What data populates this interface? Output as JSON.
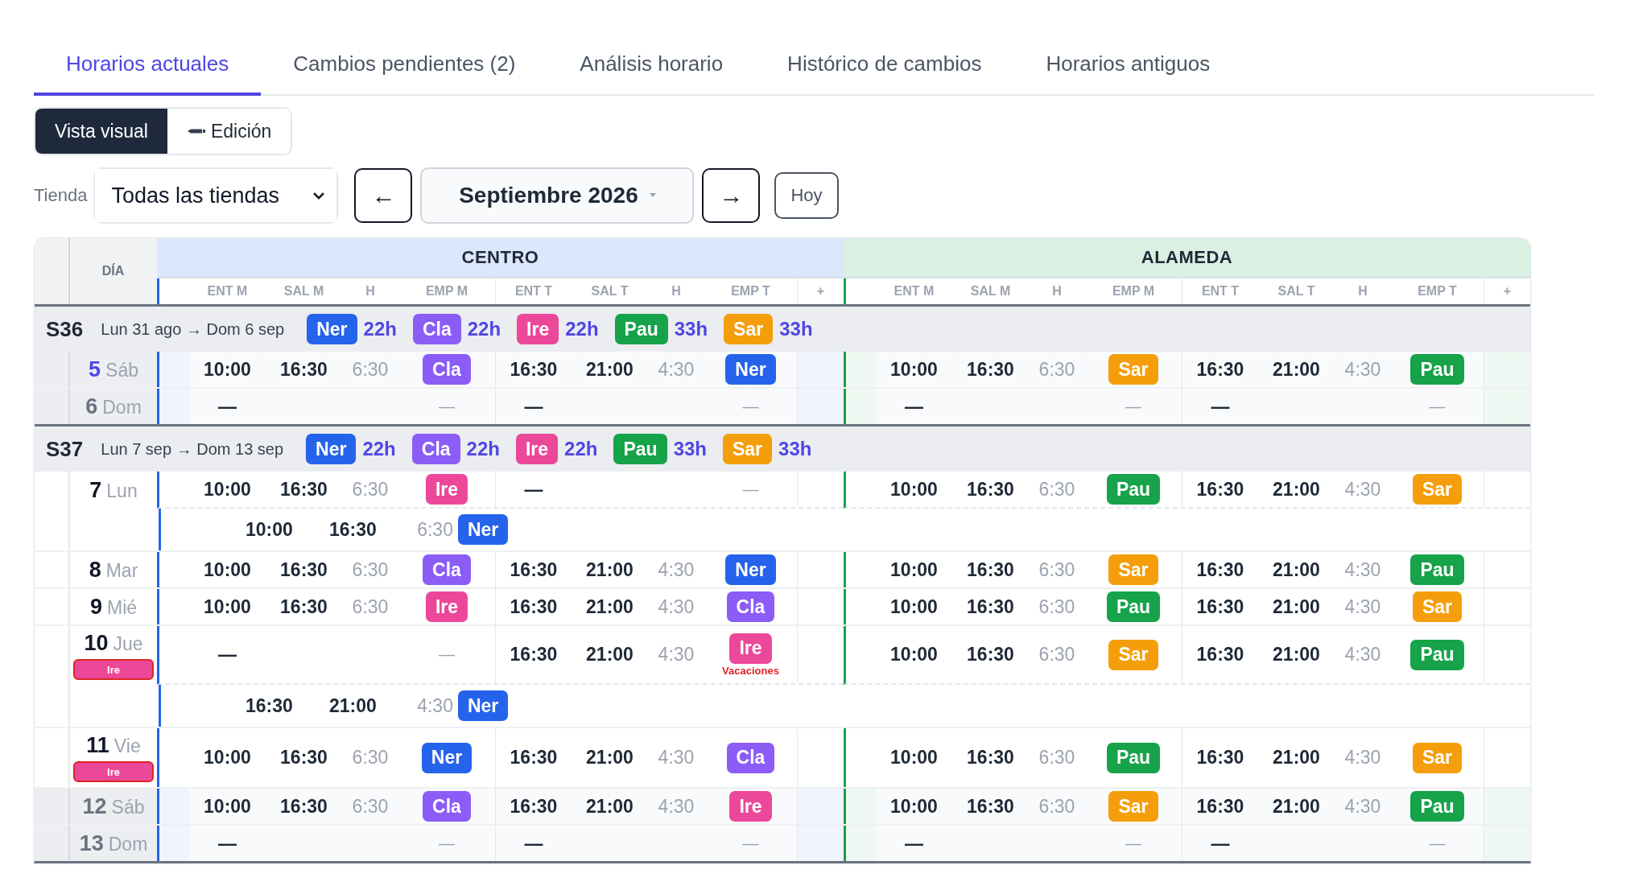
{
  "tabs": [
    {
      "label": "Horarios actuales",
      "selected": true
    },
    {
      "label": "Cambios pendientes (2)",
      "selected": false
    },
    {
      "label": "Análisis horario",
      "selected": false
    },
    {
      "label": "Histórico de cambios",
      "selected": false
    },
    {
      "label": "Horarios antiguos",
      "selected": false
    }
  ],
  "view_modes": [
    {
      "label": "Vista visual",
      "selected": true,
      "kind": "plain"
    },
    {
      "label": "Edición",
      "selected": false,
      "kind": "pencil"
    }
  ],
  "filters": {
    "store_label": "Tienda",
    "store_value": "Todas las tiendas",
    "prev": "←",
    "month": "Septiembre 2026",
    "next": "→",
    "today": "Hoy"
  },
  "table": {
    "day_header": "DÍA",
    "stores": [
      {
        "name": "CENTRO",
        "color": "#2563eb",
        "columns": [
          "ENT M",
          "SAL M",
          "H",
          "EMP M",
          "ENT T",
          "SAL T",
          "H",
          "EMP T",
          "+"
        ]
      },
      {
        "name": "ALAMEDA",
        "color": "#16a34a",
        "columns": [
          "ENT M",
          "SAL M",
          "H",
          "EMP M",
          "ENT T",
          "SAL T",
          "H",
          "EMP T",
          "+"
        ]
      }
    ],
    "weeks": [
      {
        "label": "S36",
        "range": "Lun 31 ago → Dom 6 sep",
        "totals": [
          {
            "name": "Ner",
            "color": "#2563eb",
            "hours": "22h"
          },
          {
            "name": "Cla",
            "color": "#8b5cf6",
            "hours": "22h"
          },
          {
            "name": "Ire",
            "color": "#ec4899",
            "hours": "22h"
          },
          {
            "name": "Pau",
            "color": "#16a34a",
            "hours": "33h"
          },
          {
            "name": "Sar",
            "color": "#f59e0b",
            "hours": "33h"
          }
        ],
        "days": [
          {
            "num": "5",
            "name": "Sáb",
            "weekend": true,
            "today": true,
            "stores": [
              {
                "shifts": [
                  {
                    "kind": "shift",
                    "start": "10:00",
                    "end": "16:30",
                    "hours": "6:30",
                    "employee": {
                      "name": "Cla",
                      "color": "#8b5cf6"
                    }
                  },
                  {
                    "kind": "shift",
                    "start": "16:30",
                    "end": "21:00",
                    "hours": "4:30",
                    "employee": {
                      "name": "Ner",
                      "color": "#2563eb"
                    }
                  }
                ]
              },
              {
                "shifts": [
                  {
                    "kind": "shift",
                    "start": "10:00",
                    "end": "16:30",
                    "hours": "6:30",
                    "employee": {
                      "name": "Sar",
                      "color": "#f59e0b"
                    }
                  },
                  {
                    "kind": "shift",
                    "start": "16:30",
                    "end": "21:00",
                    "hours": "4:30",
                    "employee": {
                      "name": "Pau",
                      "color": "#16a34a"
                    }
                  }
                ]
              }
            ]
          },
          {
            "num": "6",
            "name": "Dom",
            "weekend": true,
            "today": false,
            "stores": [
              {
                "shifts": [
                  {
                    "kind": "off",
                    "start": "—",
                    "employee_dash": "—"
                  },
                  {
                    "kind": "off",
                    "start": "—",
                    "employee_dash": "—"
                  }
                ]
              },
              {
                "shifts": [
                  {
                    "kind": "off",
                    "start": "—",
                    "employee_dash": "—"
                  },
                  {
                    "kind": "off",
                    "start": "—",
                    "employee_dash": "—"
                  }
                ]
              }
            ]
          }
        ]
      },
      {
        "label": "S37",
        "range": "Lun 7 sep → Dom 13 sep",
        "totals": [
          {
            "name": "Ner",
            "color": "#2563eb",
            "hours": "22h"
          },
          {
            "name": "Cla",
            "color": "#8b5cf6",
            "hours": "22h"
          },
          {
            "name": "Ire",
            "color": "#ec4899",
            "hours": "22h"
          },
          {
            "name": "Pau",
            "color": "#16a34a",
            "hours": "33h"
          },
          {
            "name": "Sar",
            "color": "#f59e0b",
            "hours": "33h"
          }
        ],
        "days": [
          {
            "num": "7",
            "name": "Lun",
            "weekend": false,
            "today": false,
            "stores": [
              {
                "shifts": [
                  {
                    "kind": "shift",
                    "start": "10:00",
                    "end": "16:30",
                    "hours": "6:30",
                    "employee": {
                      "name": "Ire",
                      "color": "#ec4899"
                    }
                  },
                  {
                    "kind": "off",
                    "start": "—",
                    "employee_dash": "—"
                  }
                ]
              },
              {
                "shifts": [
                  {
                    "kind": "shift",
                    "start": "10:00",
                    "end": "16:30",
                    "hours": "6:30",
                    "employee": {
                      "name": "Pau",
                      "color": "#16a34a"
                    }
                  },
                  {
                    "kind": "shift",
                    "start": "16:30",
                    "end": "21:00",
                    "hours": "4:30",
                    "employee": {
                      "name": "Sar",
                      "color": "#f59e0b"
                    }
                  }
                ]
              }
            ],
            "extra": [
              {
                "start": "10:00",
                "end": "16:30",
                "hours": "6:30",
                "employee": {
                  "name": "Ner",
                  "color": "#2563eb"
                }
              }
            ]
          },
          {
            "num": "8",
            "name": "Mar",
            "weekend": false,
            "today": false,
            "stores": [
              {
                "shifts": [
                  {
                    "kind": "shift",
                    "start": "10:00",
                    "end": "16:30",
                    "hours": "6:30",
                    "employee": {
                      "name": "Cla",
                      "color": "#8b5cf6"
                    }
                  },
                  {
                    "kind": "shift",
                    "start": "16:30",
                    "end": "21:00",
                    "hours": "4:30",
                    "employee": {
                      "name": "Ner",
                      "color": "#2563eb"
                    }
                  }
                ]
              },
              {
                "shifts": [
                  {
                    "kind": "shift",
                    "start": "10:00",
                    "end": "16:30",
                    "hours": "6:30",
                    "employee": {
                      "name": "Sar",
                      "color": "#f59e0b"
                    }
                  },
                  {
                    "kind": "shift",
                    "start": "16:30",
                    "end": "21:00",
                    "hours": "4:30",
                    "employee": {
                      "name": "Pau",
                      "color": "#16a34a"
                    }
                  }
                ]
              }
            ]
          },
          {
            "num": "9",
            "name": "Mié",
            "weekend": false,
            "today": false,
            "stores": [
              {
                "shifts": [
                  {
                    "kind": "shift",
                    "start": "10:00",
                    "end": "16:30",
                    "hours": "6:30",
                    "employee": {
                      "name": "Ire",
                      "color": "#ec4899"
                    }
                  },
                  {
                    "kind": "shift",
                    "start": "16:30",
                    "end": "21:00",
                    "hours": "4:30",
                    "employee": {
                      "name": "Cla",
                      "color": "#8b5cf6"
                    }
                  }
                ]
              },
              {
                "shifts": [
                  {
                    "kind": "shift",
                    "start": "10:00",
                    "end": "16:30",
                    "hours": "6:30",
                    "employee": {
                      "name": "Pau",
                      "color": "#16a34a"
                    }
                  },
                  {
                    "kind": "shift",
                    "start": "16:30",
                    "end": "21:00",
                    "hours": "4:30",
                    "employee": {
                      "name": "Sar",
                      "color": "#f59e0b"
                    }
                  }
                ]
              }
            ]
          },
          {
            "num": "10",
            "name": "Jue",
            "weekend": false,
            "today": false,
            "tags": [
              {
                "name": "Ire",
                "color": "#ec4899"
              }
            ],
            "stores": [
              {
                "shifts": [
                  {
                    "kind": "off",
                    "start": "—",
                    "employee_dash": "—"
                  },
                  {
                    "kind": "shift",
                    "start": "16:30",
                    "end": "21:00",
                    "hours": "4:30",
                    "employee": {
                      "name": "Ire",
                      "color": "#ec4899"
                    },
                    "note": "Vacaciones"
                  }
                ]
              },
              {
                "shifts": [
                  {
                    "kind": "shift",
                    "start": "10:00",
                    "end": "16:30",
                    "hours": "6:30",
                    "employee": {
                      "name": "Sar",
                      "color": "#f59e0b"
                    }
                  },
                  {
                    "kind": "shift",
                    "start": "16:30",
                    "end": "21:00",
                    "hours": "4:30",
                    "employee": {
                      "name": "Pau",
                      "color": "#16a34a"
                    }
                  }
                ]
              }
            ],
            "extra": [
              {
                "start": "16:30",
                "end": "21:00",
                "hours": "4:30",
                "employee": {
                  "name": "Ner",
                  "color": "#2563eb"
                }
              }
            ]
          },
          {
            "num": "11",
            "name": "Vie",
            "weekend": false,
            "today": false,
            "tags": [
              {
                "name": "Ire",
                "color": "#ec4899"
              }
            ],
            "stores": [
              {
                "shifts": [
                  {
                    "kind": "shift",
                    "start": "10:00",
                    "end": "16:30",
                    "hours": "6:30",
                    "employee": {
                      "name": "Ner",
                      "color": "#2563eb"
                    }
                  },
                  {
                    "kind": "shift",
                    "start": "16:30",
                    "end": "21:00",
                    "hours": "4:30",
                    "employee": {
                      "name": "Cla",
                      "color": "#8b5cf6"
                    }
                  }
                ]
              },
              {
                "shifts": [
                  {
                    "kind": "shift",
                    "start": "10:00",
                    "end": "16:30",
                    "hours": "6:30",
                    "employee": {
                      "name": "Pau",
                      "color": "#16a34a"
                    }
                  },
                  {
                    "kind": "shift",
                    "start": "16:30",
                    "end": "21:00",
                    "hours": "4:30",
                    "employee": {
                      "name": "Sar",
                      "color": "#f59e0b"
                    }
                  }
                ]
              }
            ]
          },
          {
            "num": "12",
            "name": "Sáb",
            "weekend": true,
            "today": false,
            "stores": [
              {
                "shifts": [
                  {
                    "kind": "shift",
                    "start": "10:00",
                    "end": "16:30",
                    "hours": "6:30",
                    "employee": {
                      "name": "Cla",
                      "color": "#8b5cf6"
                    }
                  },
                  {
                    "kind": "shift",
                    "start": "16:30",
                    "end": "21:00",
                    "hours": "4:30",
                    "employee": {
                      "name": "Ire",
                      "color": "#ec4899"
                    }
                  }
                ]
              },
              {
                "shifts": [
                  {
                    "kind": "shift",
                    "start": "10:00",
                    "end": "16:30",
                    "hours": "6:30",
                    "employee": {
                      "name": "Sar",
                      "color": "#f59e0b"
                    }
                  },
                  {
                    "kind": "shift",
                    "start": "16:30",
                    "end": "21:00",
                    "hours": "4:30",
                    "employee": {
                      "name": "Pau",
                      "color": "#16a34a"
                    }
                  }
                ]
              }
            ]
          },
          {
            "num": "13",
            "name": "Dom",
            "weekend": true,
            "today": false,
            "stores": [
              {
                "shifts": [
                  {
                    "kind": "off",
                    "start": "—",
                    "employee_dash": "—"
                  },
                  {
                    "kind": "off",
                    "start": "—",
                    "employee_dash": "—"
                  }
                ]
              },
              {
                "shifts": [
                  {
                    "kind": "off",
                    "start": "—",
                    "employee_dash": "—"
                  },
                  {
                    "kind": "off",
                    "start": "—",
                    "employee_dash": "—"
                  }
                ]
              }
            ]
          }
        ]
      }
    ]
  }
}
